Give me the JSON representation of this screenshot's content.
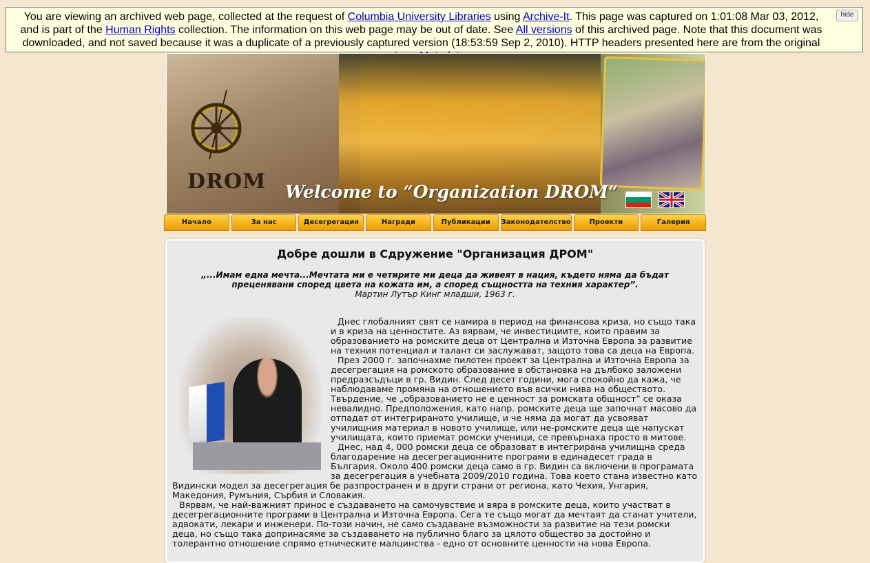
{
  "banner": {
    "t1": "You are viewing an archived web page, collected at the request of ",
    "link_columbia": "Columbia University Libraries",
    "t2": " using ",
    "link_archiveit": "Archive-It",
    "t3": ". This page was captured on 1:01:08 Mar 03, 2012, and is part of the ",
    "link_human_rights": "Human Rights",
    "t4": " collection. The information on this web page may be out of date. See ",
    "link_all_versions": "All versions",
    "t5": " of this archived page. Note that this document was downloaded, and not saved because it was a duplicate of a previously captured version (18:53:59 Sep 2, 2010). HTTP headers presented here are from the original capture. ",
    "link_metadata": "Metadata",
    "hide_label": "hide"
  },
  "header": {
    "logo_text": "DROM",
    "welcome": "Welcome to “Organization DROM“"
  },
  "nav": {
    "items": [
      "Начало",
      "За нас",
      "Десегрегация",
      "Награди",
      "Публикации",
      "Законодателство",
      "Проекти",
      "Галерия"
    ]
  },
  "content": {
    "title": "Добре дошли в Сдружение \"Организация ДРОМ\"",
    "quote": "„...Имам една мечта...Мечтата ми е четирите ми деца да живеят в нация, където няма да бъдат преценявани според цвета на кожата им, а според същността на техния характер”.",
    "quote_author": "Мартин Лутър Кинг младши, 1963 г.",
    "paragraphs": [
      "Днес глобалният свят се намира в период на финансова криза, но също така и в криза на ценностите. Аз вярвам, че инвестициите, които правим за образованието на ромските деца от Централна и Източна Европа за развитие на техния потенциал и талант си заслужават, защото това са деца на Европа.",
      "През 2000 г. започнахме пилотен проект за Централна и Източна Европа за десегрегация на ромското образование в обстановка на дълбоко заложени предразсъдъци в гр. Видин. След десет години, мога спокойно да кажа, че наблюдаваме промяна на отношението във всички нива на обществото. Твърдение, че „образованието не е ценност за ромската общност” се оказа невалидно. Предположения, като напр. ромските деца ще започнат масово да отпадат от интегрираното училище, и че няма да могат да усвояват училищния материал в новото училище, или не-ромските деца ще напускат училищата, които приемат ромски ученици, се превърнаха просто в митове.",
      "Днес, над 4, 000 ромски деца се образоват в интегрирана училищна среда благодарение на десегрегационните програми в единадесет града в България. Около 400 ромски деца само в гр. Видин са включени в програмата за десегрегация в учебната 2009/2010 година. Това което стана известно като Видински модел за десегрегация бе разпространен и в други страни от региона, като Чехия, Унгария, Македония, Румъния, Сърбия и Словакия.",
      "Вярвам, че най-важният принос е създаването на самочувствие и вяра в ромските деца, които участват в десегрегационните програми в Централна и Източна Европа. Сега те също могат да мечтаят да станат учители, адвокати, лекари и инженери. По-този начин, не само създаване възможности за развитие на тези ромски деца, но също така допринасяме за създаването на публично благо за цялото общество за достойно и толерантно отношение спрямо етническите малцинства - едно от основните ценности на нова Европа."
    ]
  }
}
